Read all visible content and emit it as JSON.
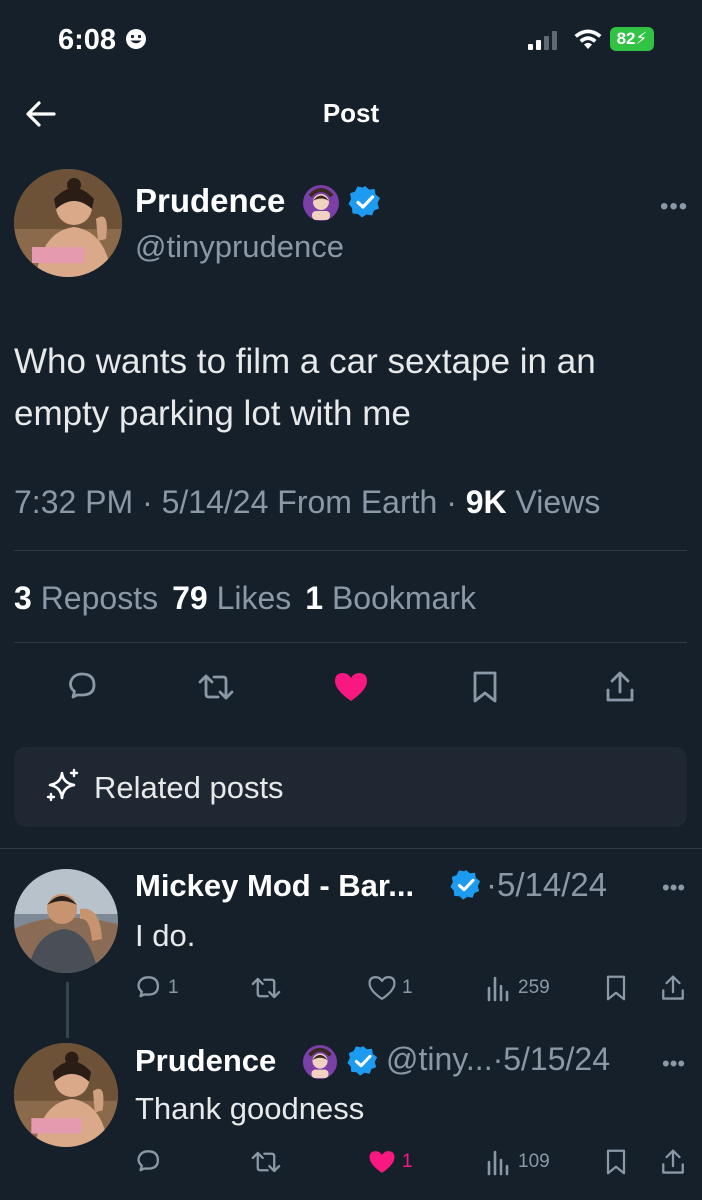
{
  "status_bar": {
    "time": "6:08",
    "battery": "82"
  },
  "header": {
    "title": "Post"
  },
  "post": {
    "author_name": "Prudence",
    "author_emoji": "🙆🏻‍♀️",
    "author_handle": "@tinyprudence",
    "text": "Who wants to film a car sextape in an empty parking lot with me",
    "time": "7:32 PM",
    "date": "5/14/24",
    "location": "From Earth",
    "views_count": "9K",
    "views_label": "Views",
    "reposts_count": "3",
    "reposts_label": "Reposts",
    "likes_count": "79",
    "likes_label": "Likes",
    "bookmarks_count": "1",
    "bookmarks_label": "Bookmark",
    "liked": true
  },
  "related": {
    "label": "Related posts"
  },
  "replies": [
    {
      "author_name": "Mickey Mod - Bar...",
      "date": "5/14/24",
      "text": "I do.",
      "replies_count": "1",
      "likes_count": "1",
      "views_count": "259",
      "liked": false
    },
    {
      "author_name": "Prudence",
      "author_emoji": "🙆🏻‍♀️",
      "author_handle": "@tiny...",
      "date": "5/15/24",
      "text": "Thank goodness",
      "likes_count": "1",
      "views_count": "109",
      "liked": true
    }
  ],
  "colors": {
    "background": "#15202b",
    "verified": "#1d9bf0",
    "like": "#f91880",
    "battery": "#32c244"
  }
}
